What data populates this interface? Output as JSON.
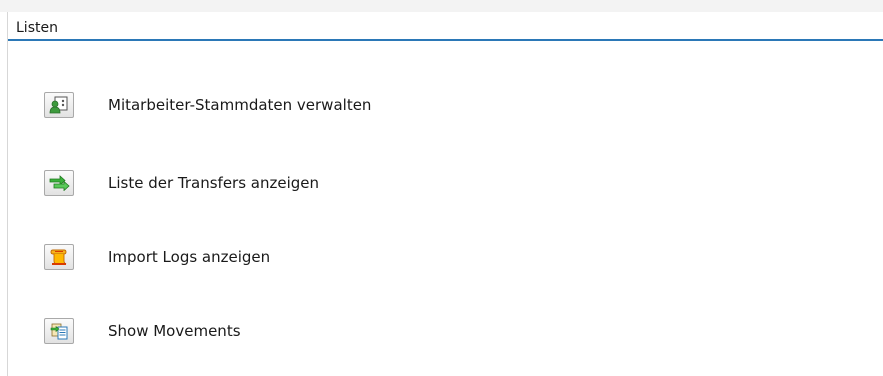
{
  "group": {
    "title": "Listen"
  },
  "actions": [
    {
      "label": "Mitarbeiter-Stammdaten verwalten",
      "icon": "employee-masterdata-icon"
    },
    {
      "label": "Liste der Transfers anzeigen",
      "icon": "transfer-arrows-icon"
    },
    {
      "label": "Import Logs anzeigen",
      "icon": "log-scroll-icon"
    },
    {
      "label": "Show Movements",
      "icon": "movements-document-icon"
    }
  ],
  "colors": {
    "header_underline": "#2b78b7",
    "text": "#1a1a1a",
    "button_border": "#a9a9a9"
  }
}
